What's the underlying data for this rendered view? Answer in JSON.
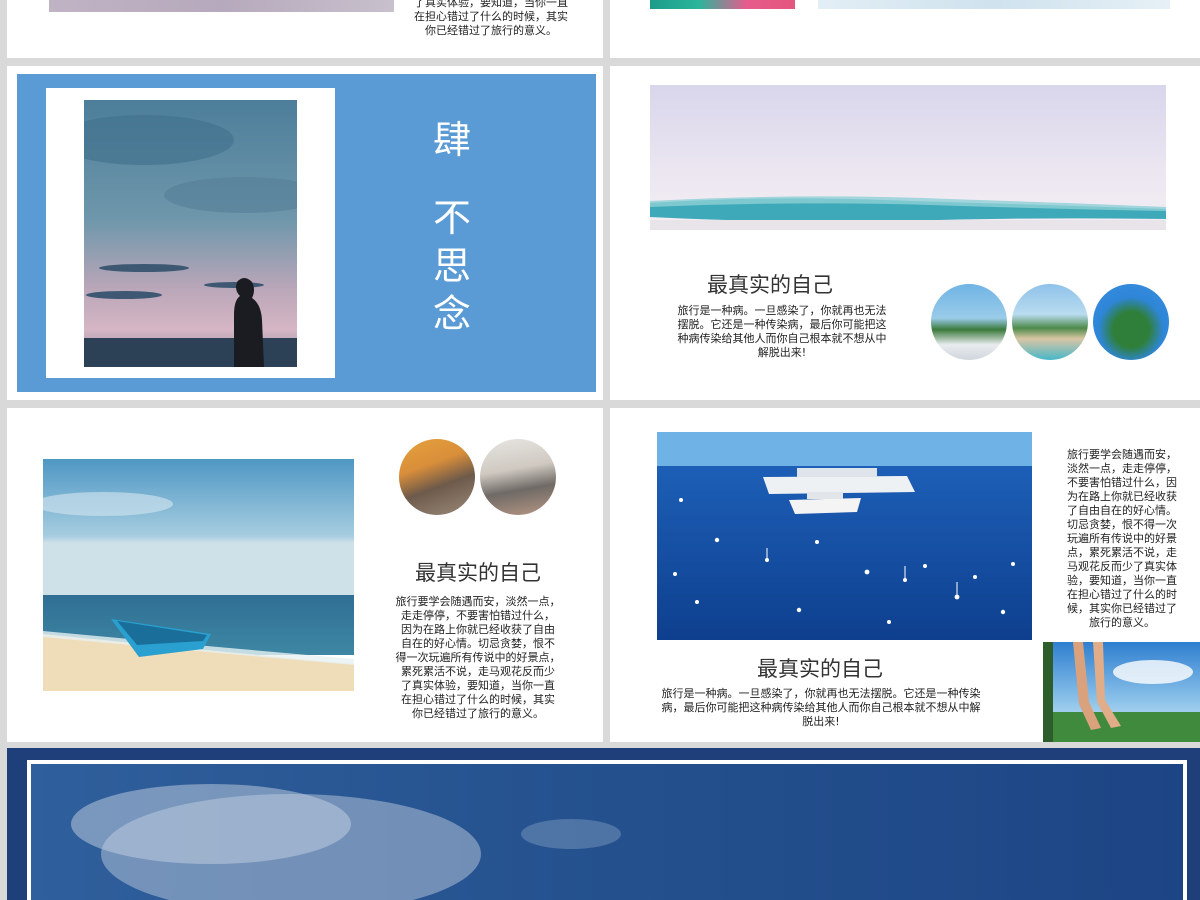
{
  "slide_top_left": {
    "body_lines": [
      "了真实体验，要知道，当你一直",
      "在担心错过了什么的时候，其实",
      "你已经错过了旅行的意义。"
    ]
  },
  "slide_cover": {
    "title_char": "肆",
    "subtitle_chars": [
      "不",
      "思",
      "念"
    ],
    "colors": {
      "panel": "#5b9bd5"
    }
  },
  "slide_wave": {
    "heading": "最真实的自己",
    "body_lines": [
      "旅行是一种病。一旦感染了，你就再也无法",
      "摆脱。它还是一种传染病，最后你可能把这",
      "种病传染给其他人而你自己根本就不想从中",
      "解脱出来!"
    ]
  },
  "slide_boat": {
    "heading": "最真实的自己",
    "body_lines": [
      "旅行要学会随遇而安，淡然一点，",
      "走走停停，不要害怕错过什么，",
      "因为在路上你就已经收获了自由",
      "自在的好心情。切忌贪婪，恨不",
      "得一次玩遍所有传说中的好景点，",
      "累死累活不说，走马观花反而少",
      "了真实体验，要知道，当你一直",
      "在担心错过了什么的时候，其实",
      "你已经错过了旅行的意义。"
    ]
  },
  "slide_ship": {
    "heading": "最真实的自己",
    "body_lines": [
      "旅行是一种病。一旦感染了，你就再也无法摆脱。它还是一种传染",
      "病，最后你可能把这种病传染给其他人而你自己根本就不想从中解",
      "脱出来!"
    ],
    "side_lines": [
      "旅行要学会随遇而安，",
      "淡然一点，走走停停，",
      "不要害怕错过什么，因",
      "为在路上你就已经收获",
      "了自由自在的好心情。",
      "切忌贪婪，恨不得一次",
      "玩遍所有传说中的好景",
      "点，累死累活不说，走",
      "马观花反而少了真实体",
      "验，要知道，当你一直",
      "在担心错过了什么的时",
      "候，其实你已经错过了",
      "旅行的意义。"
    ]
  },
  "colors": {
    "background": "#d9d9d9",
    "sky_dark": "#1f3f7a"
  }
}
